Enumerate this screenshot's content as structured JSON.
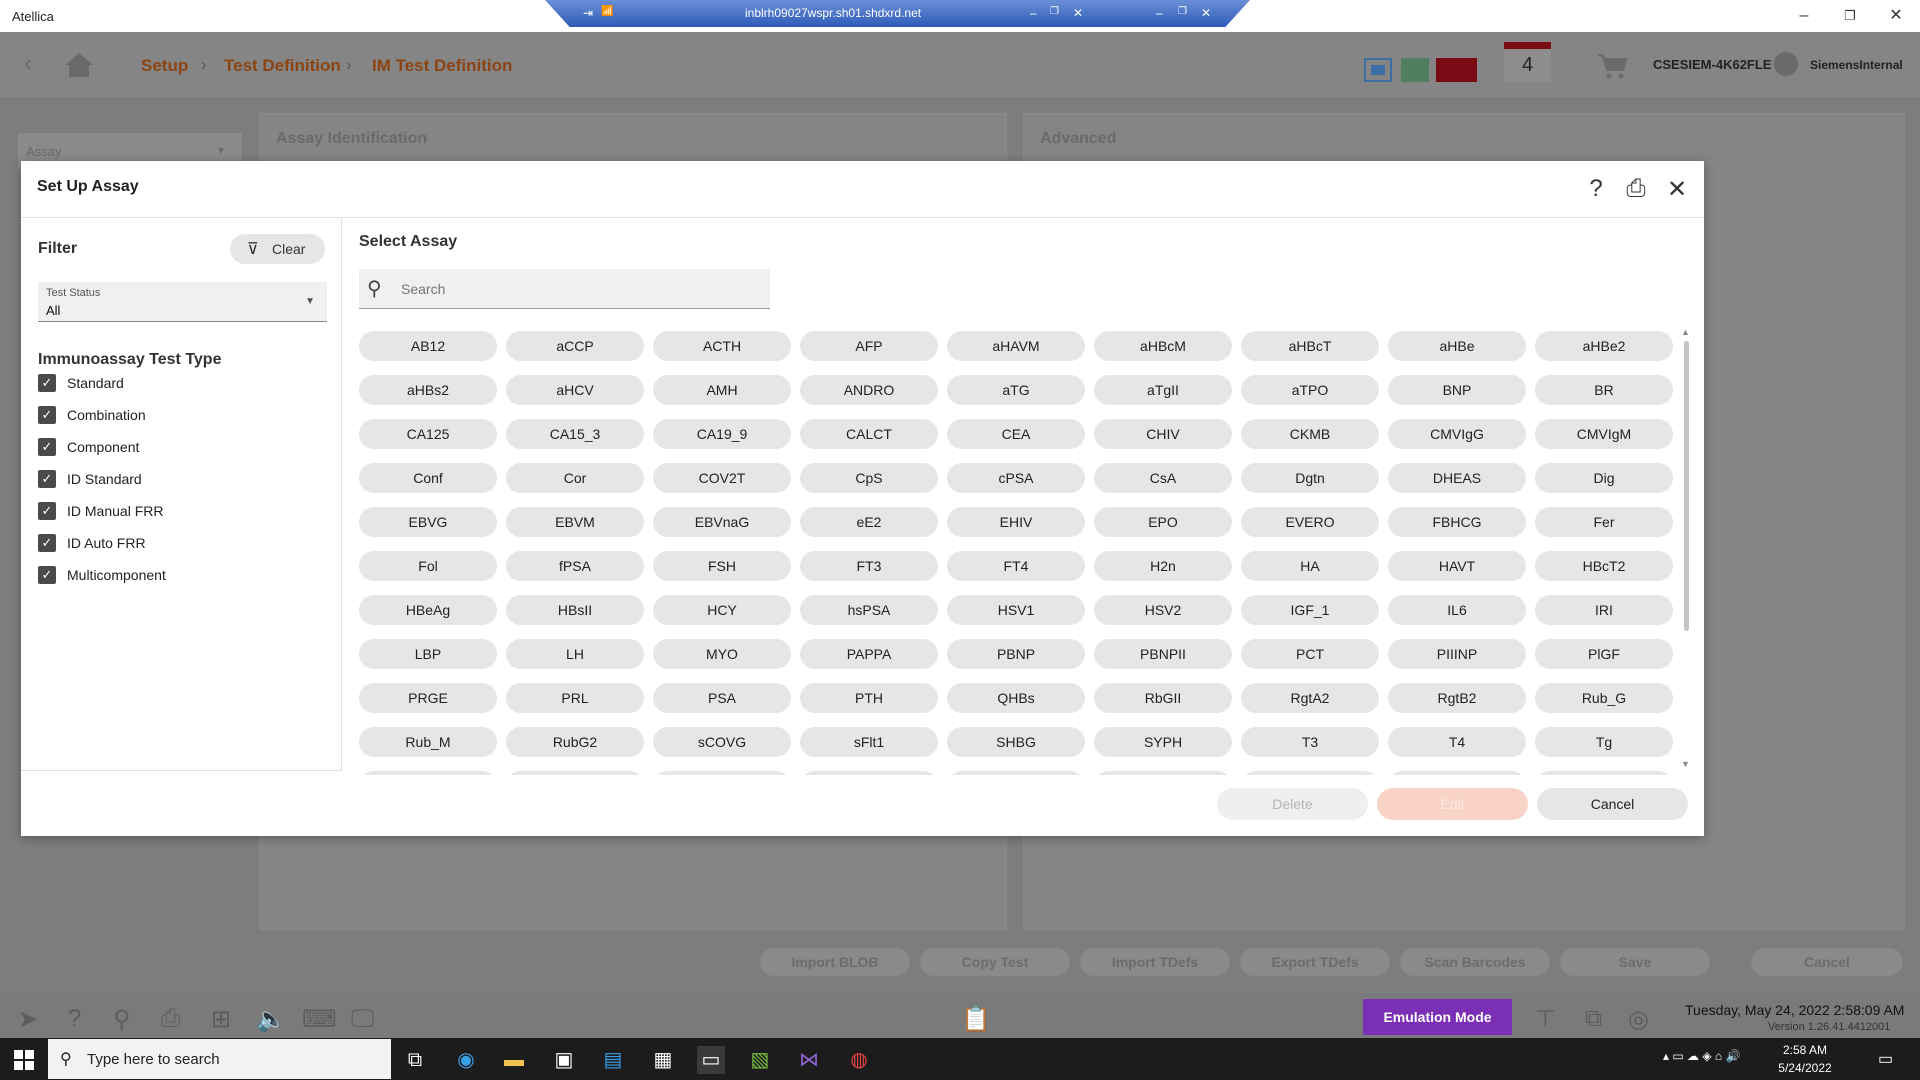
{
  "window": {
    "title": "Atellica",
    "minimize": "–",
    "restore": "❐",
    "close": "✕"
  },
  "rdp_bar": {
    "pin": "⇥",
    "signal": "📶",
    "host": "inblrh09027wspr.sh01.shdxrd.net",
    "minimize": "–",
    "restore": "❐",
    "close": "✕"
  },
  "header": {
    "breadcrumb": [
      "Setup",
      "Test Definition",
      "IM Test Definition"
    ],
    "cart_count": "4",
    "system_name": "CSESIEM-4K62FLE",
    "user_name": "SiemensInternal"
  },
  "background": {
    "assay_dropdown": "Assay",
    "panel_assay_identification": "Assay Identification",
    "panel_advanced": "Advanced",
    "bottom_buttons": [
      "Import BLOB",
      "Copy Test",
      "Import TDefs",
      "Export TDefs",
      "Scan Barcodes",
      "Save",
      "Cancel"
    ]
  },
  "dialog": {
    "title": "Set Up Assay",
    "filter": {
      "title": "Filter",
      "clear_label": "Clear",
      "test_status_label": "Test Status",
      "test_status_value": "All",
      "type_title": "Immunoassay Test Type",
      "types": [
        {
          "label": "Standard",
          "checked": true
        },
        {
          "label": "Combination",
          "checked": true
        },
        {
          "label": "Component",
          "checked": true
        },
        {
          "label": "ID Standard",
          "checked": true
        },
        {
          "label": "ID Manual FRR",
          "checked": true
        },
        {
          "label": "ID Auto FRR",
          "checked": true
        },
        {
          "label": "Multicomponent",
          "checked": true
        }
      ]
    },
    "select_assay": {
      "title": "Select Assay",
      "search_placeholder": "Search",
      "assays": [
        "AB12",
        "aCCP",
        "ACTH",
        "AFP",
        "aHAVM",
        "aHBcM",
        "aHBcT",
        "aHBe",
        "aHBe2",
        "aHBs2",
        "aHCV",
        "AMH",
        "ANDRO",
        "aTG",
        "aTgII",
        "aTPO",
        "BNP",
        "BR",
        "CA125",
        "CA15_3",
        "CA19_9",
        "CALCT",
        "CEA",
        "CHIV",
        "CKMB",
        "CMVIgG",
        "CMVIgM",
        "Conf",
        "Cor",
        "COV2T",
        "CpS",
        "cPSA",
        "CsA",
        "Dgtn",
        "DHEAS",
        "Dig",
        "EBVG",
        "EBVM",
        "EBVnaG",
        "eE2",
        "EHIV",
        "EPO",
        "EVERO",
        "FBHCG",
        "Fer",
        "Fol",
        "fPSA",
        "FSH",
        "FT3",
        "FT4",
        "H2n",
        "HA",
        "HAVT",
        "HBcT2",
        "HBeAg",
        "HBsII",
        "HCY",
        "hsPSA",
        "HSV1",
        "HSV2",
        "IGF_1",
        "IL6",
        "IRI",
        "LBP",
        "LH",
        "MYO",
        "PAPPA",
        "PBNP",
        "PBNPII",
        "PCT",
        "PIIINP",
        "PlGF",
        "PRGE",
        "PRL",
        "PSA",
        "PTH",
        "QHBs",
        "RbGII",
        "RgtA2",
        "RgtB2",
        "Rub_G",
        "Rub_M",
        "RubG2",
        "sCOVG",
        "sFlt1",
        "SHBG",
        "SYPH",
        "T3",
        "T4",
        "Tg"
      ]
    },
    "buttons": {
      "delete": "Delete",
      "edit": "Edit",
      "cancel": "Cancel"
    }
  },
  "footer": {
    "emulation_mode": "Emulation Mode",
    "datetime": "Tuesday, May 24, 2022 2:58:09 AM",
    "version": "Version 1.26.41.4412001"
  },
  "taskbar": {
    "search_placeholder": "Type here to search",
    "time": "2:58 AM",
    "date": "5/24/2022"
  },
  "colors": {
    "breadcrumb": "#8c4512",
    "emulation": "#7b2fb4",
    "dialog_bg": "#ffffff",
    "assay_pill": "#e6e6e6"
  }
}
